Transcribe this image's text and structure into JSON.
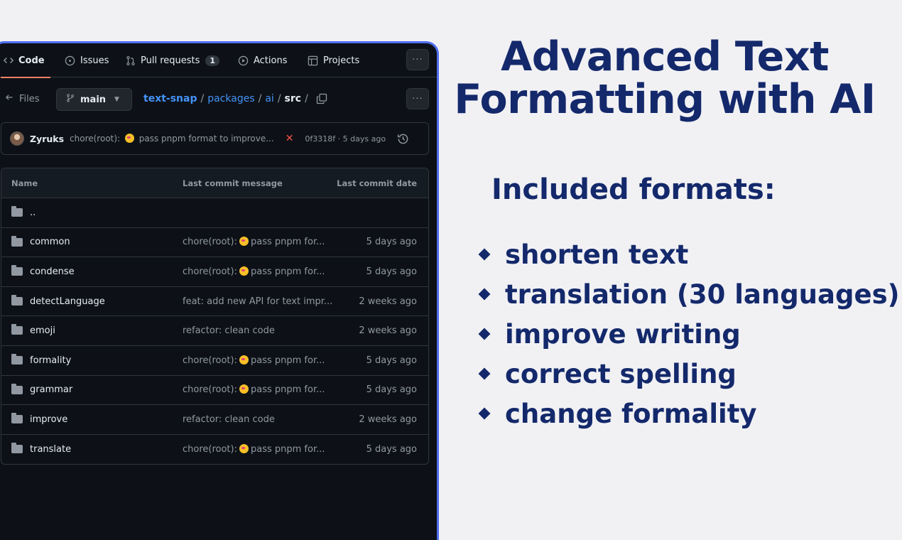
{
  "repo_panel": {
    "tabs": [
      {
        "label": "Code",
        "icon": "code-icon",
        "active": true
      },
      {
        "label": "Issues",
        "icon": "issue-opened-icon"
      },
      {
        "label": "Pull requests",
        "icon": "git-pull-request-icon",
        "count": "1"
      },
      {
        "label": "Actions",
        "icon": "play-icon"
      },
      {
        "label": "Projects",
        "icon": "table-icon"
      }
    ],
    "more_label": "···",
    "files_label": "Files",
    "branch": "main",
    "breadcrumb": {
      "repo": "text-snap",
      "segments": [
        "packages",
        "ai"
      ],
      "current": "src",
      "separator": "/"
    },
    "latest_commit": {
      "author": "Zyruks",
      "message_prefix": "chore(root):",
      "message_suffix": "pass pnpm format to improve...",
      "status": "✕",
      "sha_date": "0f3318f · 5 days ago"
    },
    "table": {
      "headers": {
        "name": "Name",
        "message": "Last commit message",
        "date": "Last commit date"
      },
      "parent_dir": "..",
      "rows": [
        {
          "name": "common",
          "message": "chore(root):",
          "message_tail": "pass pnpm for...",
          "emoji": true,
          "date": "5 days ago"
        },
        {
          "name": "condense",
          "message": "chore(root):",
          "message_tail": "pass pnpm for...",
          "emoji": true,
          "date": "5 days ago"
        },
        {
          "name": "detectLanguage",
          "message": "feat: add new API for text impr...",
          "message_tail": "",
          "emoji": false,
          "date": "2 weeks ago"
        },
        {
          "name": "emoji",
          "message": "refactor: clean code",
          "message_tail": "",
          "emoji": false,
          "date": "2 weeks ago"
        },
        {
          "name": "formality",
          "message": "chore(root):",
          "message_tail": "pass pnpm for...",
          "emoji": true,
          "date": "5 days ago"
        },
        {
          "name": "grammar",
          "message": "chore(root):",
          "message_tail": "pass pnpm for...",
          "emoji": true,
          "date": "5 days ago"
        },
        {
          "name": "improve",
          "message": "refactor: clean code",
          "message_tail": "",
          "emoji": false,
          "date": "2 weeks ago"
        },
        {
          "name": "translate",
          "message": "chore(root):",
          "message_tail": "pass pnpm for...",
          "emoji": true,
          "date": "5 days ago"
        }
      ]
    }
  },
  "promo": {
    "title_line1": "Advanced Text",
    "title_line2": "Formatting with AI",
    "formats_heading": "Included formats:",
    "formats": [
      "shorten text",
      "translation (30 languages)",
      "improve writing",
      "correct spelling",
      "change formality"
    ]
  },
  "colors": {
    "accent_border": "#4f6ef0",
    "title_navy": "#14296b",
    "link_blue": "#4493f8",
    "active_tab_underline": "#f78166"
  }
}
